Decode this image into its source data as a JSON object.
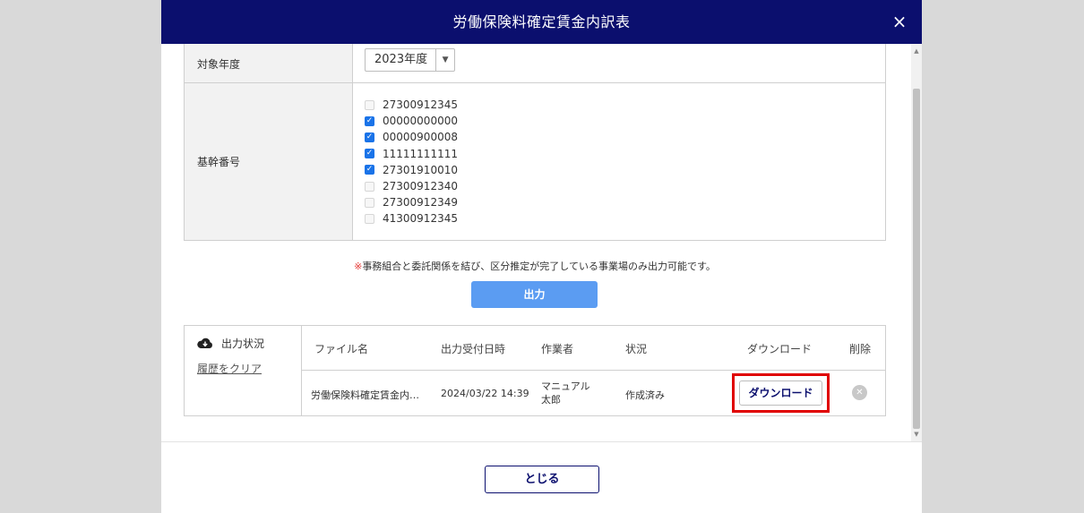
{
  "modal": {
    "title": "労働保険料確定賃金内訳表",
    "close_icon": "×"
  },
  "form": {
    "year_label": "対象年度",
    "year_value": "2023年度",
    "base_number_label": "基幹番号",
    "base_numbers": [
      {
        "number": "27300912345",
        "checked": false
      },
      {
        "number": "00000000000",
        "checked": true
      },
      {
        "number": "00000900008",
        "checked": true
      },
      {
        "number": "11111111111",
        "checked": true
      },
      {
        "number": "27301910010",
        "checked": true
      },
      {
        "number": "27300912340",
        "checked": false
      },
      {
        "number": "27300912349",
        "checked": false
      },
      {
        "number": "41300912345",
        "checked": false
      }
    ]
  },
  "notice": {
    "mark": "※",
    "text": "事務組合と委託関係を結び、区分推定が完了している事業場のみ出力可能です。"
  },
  "output_button": "出力",
  "status": {
    "title": "出力状況",
    "clear_link": "履歴をクリア",
    "columns": {
      "file": "ファイル名",
      "time": "出力受付日時",
      "worker": "作業者",
      "state": "状況",
      "download": "ダウンロード",
      "delete": "削除"
    },
    "rows": [
      {
        "file": "労働保険料確定賃金内…",
        "time": "2024/03/22 14:39",
        "worker_line1": "マニュアル",
        "worker_line2": "太郎",
        "state": "作成済み",
        "download_label": "ダウンロード"
      }
    ]
  },
  "footer": {
    "close_label": "とじる"
  },
  "colors": {
    "header_bg": "#0b0f6e",
    "accent": "#5b9cf2",
    "checkbox": "#1a73e8",
    "highlight": "#e00000"
  }
}
